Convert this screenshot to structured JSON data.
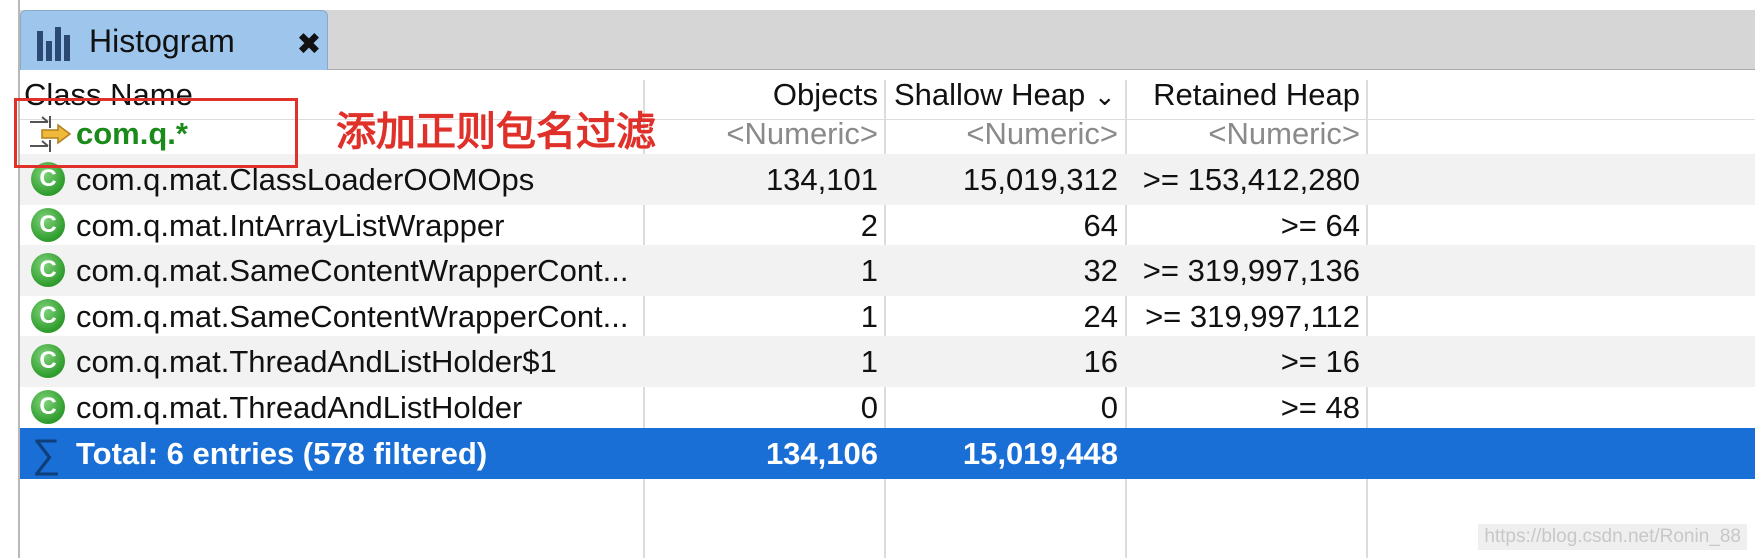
{
  "tab": {
    "label": "Histogram",
    "close_glyph": "✖"
  },
  "columns": {
    "class_name": "Class Name",
    "objects": "Objects",
    "shallow_heap": "Shallow Heap",
    "retained_heap": "Retained Heap",
    "sort_indicator": "⌄"
  },
  "filter_row": {
    "class_name": "com.q.*",
    "objects": "<Numeric>",
    "shallow_heap": "<Numeric>",
    "retained_heap": "<Numeric>"
  },
  "annotation": "添加正则包名过滤",
  "rows": [
    {
      "icon": "C",
      "class_name": "com.q.mat.ClassLoaderOOMOps",
      "objects": "134,101",
      "shallow_heap": "15,019,312",
      "retained_heap": ">= 153,412,280"
    },
    {
      "icon": "C",
      "class_name": "com.q.mat.IntArrayListWrapper",
      "objects": "2",
      "shallow_heap": "64",
      "retained_heap": ">= 64"
    },
    {
      "icon": "C",
      "class_name": "com.q.mat.SameContentWrapperCont...",
      "objects": "1",
      "shallow_heap": "32",
      "retained_heap": ">= 319,997,136"
    },
    {
      "icon": "C",
      "class_name": "com.q.mat.SameContentWrapperCont...",
      "objects": "1",
      "shallow_heap": "24",
      "retained_heap": ">= 319,997,112"
    },
    {
      "icon": "C",
      "class_name": "com.q.mat.ThreadAndListHolder$1",
      "objects": "1",
      "shallow_heap": "16",
      "retained_heap": ">= 16"
    },
    {
      "icon": "C",
      "class_name": "com.q.mat.ThreadAndListHolder",
      "objects": "0",
      "shallow_heap": "0",
      "retained_heap": ">= 48"
    }
  ],
  "total": {
    "label": "Total: 6 entries (578 filtered)",
    "objects": "134,106",
    "shallow_heap": "15,019,448",
    "retained_heap": ""
  },
  "watermark": "https://blog.csdn.net/Ronin_88",
  "colors": {
    "tab_active": "#9ec6ec",
    "selection": "#1a6fd6",
    "annotation": "#e0302a",
    "class_icon": "#2e9b2c",
    "filter_text": "#1a8a1a"
  }
}
